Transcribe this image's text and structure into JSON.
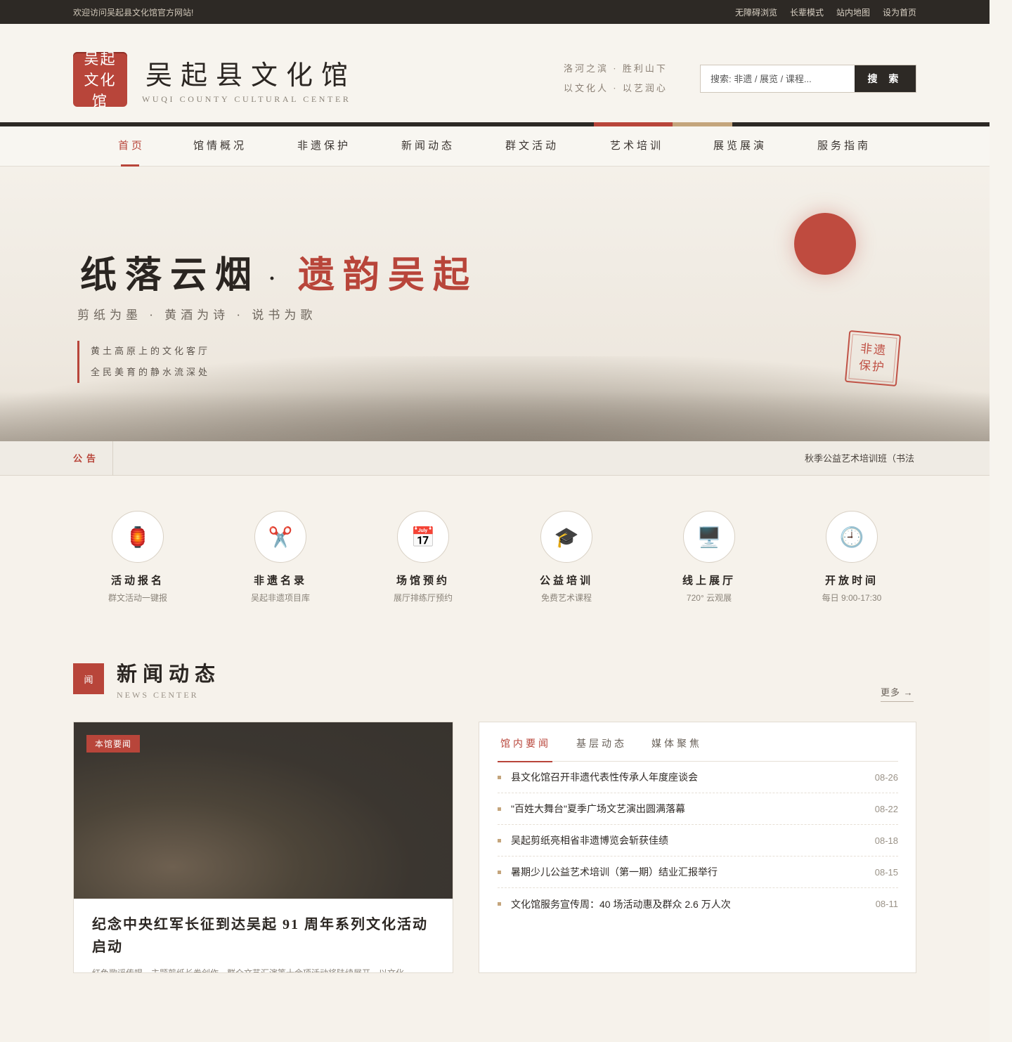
{
  "topbar": {
    "welcome": "欢迎访问吴起县文化馆官方网站!",
    "links": [
      "无障碍浏览",
      "长辈模式",
      "站内地图",
      "设为首页"
    ]
  },
  "header": {
    "seal_lines": [
      "吴起",
      "文化",
      "馆"
    ],
    "name": "吴起县文化馆",
    "name_en": "WUQI COUNTY CULTURAL CENTER",
    "motto_line1": "洛河之滨 · 胜利山下",
    "motto_line2": "以文化人 · 以艺润心",
    "search_placeholder": "搜索: 非遗 / 展览 / 课程...",
    "search_button": "搜 索"
  },
  "nav": {
    "items": [
      "首页",
      "馆情概况",
      "非遗保护",
      "新闻动态",
      "群文活动",
      "艺术培训",
      "展览展演",
      "服务指南"
    ],
    "active_index": 0
  },
  "hero": {
    "title_main": "纸落云烟",
    "title_dot": "·",
    "title_accent": "遗韵吴起",
    "subtitle": "剪纸为墨 · 黄酒为诗 · 说书为歌",
    "quote_line1": "黄土高原上的文化客厅",
    "quote_line2": "全民美育的静水流深处",
    "stamp": [
      "非遗",
      "保护"
    ]
  },
  "notice": {
    "label": "公告",
    "text": "秋季公益艺术培训班（书法"
  },
  "quick_links": [
    {
      "icon": "lantern-icon",
      "glyph": "🏮",
      "name": "活动报名",
      "desc": "群文活动一键报"
    },
    {
      "icon": "scissors-icon",
      "glyph": "✂️",
      "name": "非遗名录",
      "desc": "吴起非遗项目库"
    },
    {
      "icon": "calendar-icon",
      "glyph": "📅",
      "name": "场馆预约",
      "desc": "展厅排练厅预约"
    },
    {
      "icon": "graduation-cap-icon",
      "glyph": "🎓",
      "name": "公益培训",
      "desc": "免费艺术课程"
    },
    {
      "icon": "monitor-icon",
      "glyph": "🖥️",
      "name": "线上展厅",
      "desc": "720° 云观展"
    },
    {
      "icon": "clock-icon",
      "glyph": "🕘",
      "name": "开放时间",
      "desc": "每日 9:00-17:30"
    }
  ],
  "news": {
    "badge": "闻",
    "title": "新闻动态",
    "title_en": "NEWS CENTER",
    "more": "更多 →",
    "feature": {
      "tag": "本馆要闻",
      "title": "纪念中央红军长征到达吴起 91 周年系列文化活动启动",
      "desc": "红色歌谣传唱、主题剪纸长卷创作、群众文艺汇演等十余项活动将陆续展开，以文化"
    },
    "tabs": [
      "馆内要闻",
      "基层动态",
      "媒体聚焦"
    ],
    "active_tab": 0,
    "list": [
      {
        "title": "县文化馆召开非遗代表性传承人年度座谈会",
        "date": "08-26"
      },
      {
        "title": "\"百姓大舞台\"夏季广场文艺演出圆满落幕",
        "date": "08-22"
      },
      {
        "title": "吴起剪纸亮相省非遗博览会斩获佳绩",
        "date": "08-18"
      },
      {
        "title": "暑期少儿公益艺术培训（第一期）结业汇报举行",
        "date": "08-15"
      },
      {
        "title": "文化馆服务宣传周：40 场活动惠及群众 2.6 万人次",
        "date": "08-11"
      }
    ]
  },
  "colors": {
    "accent": "#b8453a",
    "dark": "#2d2925",
    "tan": "#c4a57c",
    "bg": "#f6f2eb"
  }
}
